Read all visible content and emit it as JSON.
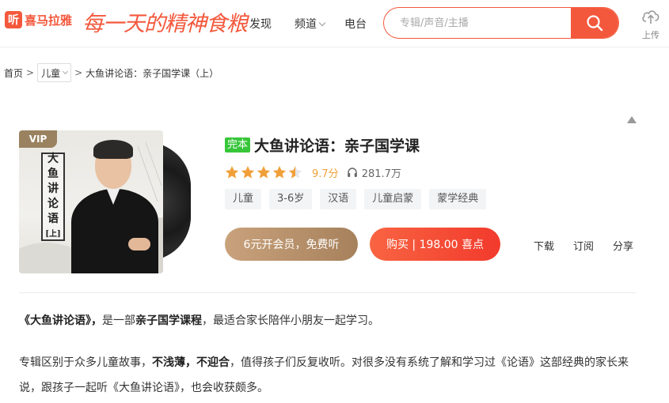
{
  "header": {
    "logo_mark": "听",
    "logo_text": "喜马拉雅",
    "slogan": "每一天的精神食粮",
    "nav": [
      {
        "label": "发现"
      },
      {
        "label": "频道"
      },
      {
        "label": "电台"
      }
    ],
    "search_placeholder": "专辑/声音/主播",
    "upload_label": "上传"
  },
  "breadcrumb": {
    "home": "首页",
    "sep1": ">",
    "category": "儿童",
    "sep2": ">",
    "current": "大鱼讲论语：亲子国学课（上）"
  },
  "album": {
    "cover": {
      "vip_label": "VIP",
      "title_chars": [
        "大",
        "鱼",
        "讲",
        "论",
        "语",
        "[上]"
      ]
    },
    "status_badge": "完本",
    "title": "大鱼讲论语：亲子国学课",
    "rating": 4.5,
    "score": "9.7分",
    "plays": "281.7万",
    "tags": [
      "儿童",
      "3-6岁",
      "汉语",
      "儿童启蒙",
      "蒙学经典"
    ],
    "vip_button": "6元开会员，免费听",
    "buy_button": "购买 | 198.00 喜点",
    "actions": {
      "download": "下载",
      "subscribe": "订阅",
      "share": "分享"
    }
  },
  "intro": {
    "p1": {
      "b1": "《大鱼讲论语》，",
      "t1": "是一部",
      "b2": "亲子国学课程",
      "t2": "，最适合家长陪伴小朋友一起学习。"
    },
    "p2": {
      "t1": "专辑区别于众多儿童故事，",
      "b1": "不浅薄，不迎合",
      "t2": "，值得孩子们反复收听。对很多没有系统了解和学习过《论语》这部经典的家长来说，跟孩子一起听《大鱼讲论语》，也会收获颇多。"
    }
  },
  "colors": {
    "brand": "#f4583c",
    "done_badge": "#37c63a",
    "star": "#f0a03a",
    "vip_gold": "#b89069",
    "buy_red": "#f23a2c"
  }
}
